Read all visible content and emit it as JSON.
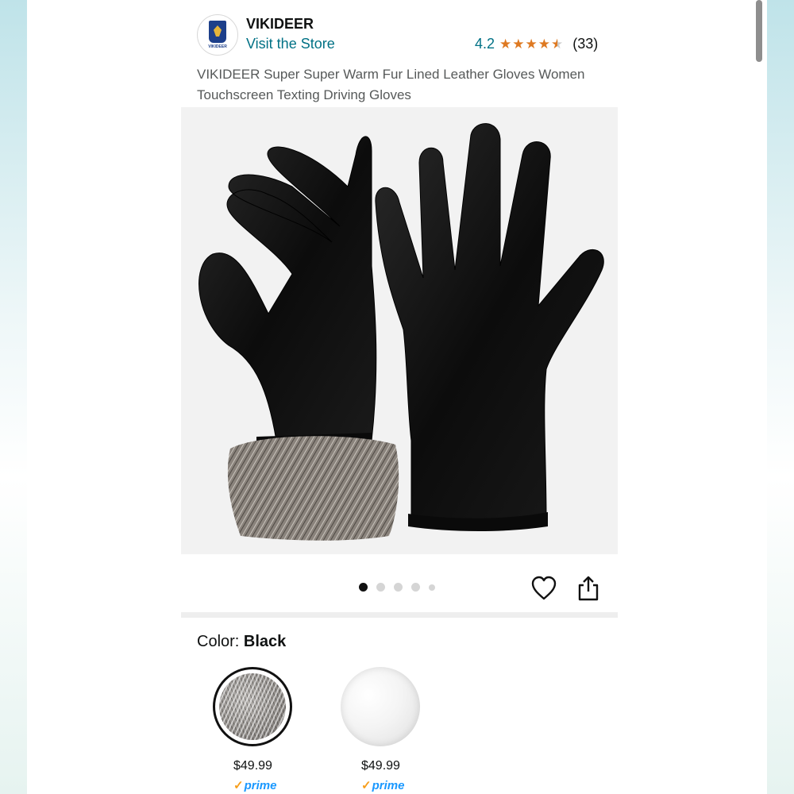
{
  "header": {
    "brand": "VIKIDEER",
    "logo_text": "VIKIDEER",
    "visit_store": "Visit the Store",
    "rating": "4.2",
    "rating_stars": 4.2,
    "review_count": "(33)"
  },
  "product": {
    "title": "VIKIDEER Super Super Warm Fur Lined Leather Gloves Women Touchscreen Texting Driving Gloves"
  },
  "gallery": {
    "image_count": 5,
    "active_index": 0,
    "heart_icon": "heart-icon",
    "share_icon": "share-icon"
  },
  "color": {
    "label": "Color: ",
    "selected": "Black",
    "options": [
      {
        "swatch": "grey-fur",
        "price": "$49.99",
        "prime": "prime"
      },
      {
        "swatch": "white-fur",
        "price": "$49.99",
        "prime": "prime"
      }
    ]
  },
  "colors": {
    "link": "#007185",
    "star": "#de7921",
    "prime_blue": "#1a98ff",
    "prime_check": "#f79e1b"
  }
}
